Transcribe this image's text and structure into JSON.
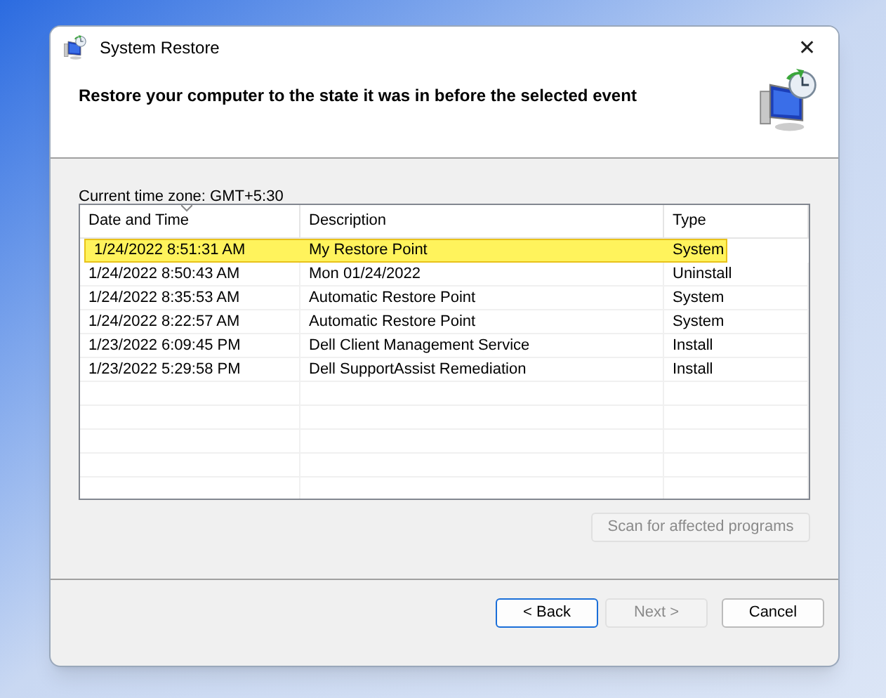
{
  "window": {
    "title": "System Restore",
    "close": "✕"
  },
  "heading": "Restore your computer to the state it was in before the selected event",
  "time_zone": "Current time zone: GMT+5:30",
  "table": {
    "columns": [
      {
        "label": "Date and Time",
        "sorted": true
      },
      {
        "label": "Description",
        "sorted": false
      },
      {
        "label": "Type",
        "sorted": false
      }
    ],
    "rows": [
      {
        "cells": [
          "1/24/2022 8:51:31 AM",
          "My Restore Point",
          "System"
        ],
        "selected": true
      },
      {
        "cells": [
          "1/24/2022 8:50:43 AM",
          "Mon 01/24/2022",
          "Uninstall"
        ],
        "selected": false
      },
      {
        "cells": [
          "1/24/2022 8:35:53 AM",
          "Automatic Restore Point",
          "System"
        ],
        "selected": false
      },
      {
        "cells": [
          "1/24/2022 8:22:57 AM",
          "Automatic Restore Point",
          "System"
        ],
        "selected": false
      },
      {
        "cells": [
          "1/23/2022 6:09:45 PM",
          "Dell Client Management Service",
          "Install"
        ],
        "selected": false
      },
      {
        "cells": [
          "1/23/2022 5:29:58 PM",
          "Dell SupportAssist Remediation",
          "Install"
        ],
        "selected": false
      }
    ]
  },
  "scan_button": {
    "label": "Scan for affected programs",
    "disabled": true
  },
  "buttons": [
    {
      "label": "< Back",
      "disabled": false,
      "focused": true
    },
    {
      "label": "Next >",
      "disabled": true,
      "focused": false
    },
    {
      "label": "Cancel",
      "disabled": false,
      "focused": false
    }
  ]
}
